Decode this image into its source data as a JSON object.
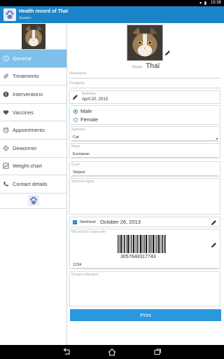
{
  "status_bar": {
    "time": "15:36"
  },
  "action_bar": {
    "title": "Health record of Thaï",
    "subtitle": "Ajouter"
  },
  "sidebar": {
    "items": [
      {
        "label": "General",
        "icon": "info-icon",
        "active": true
      },
      {
        "label": "Treatments",
        "icon": "pill-icon"
      },
      {
        "label": "Interventions",
        "icon": "alert-icon"
      },
      {
        "label": "Vaccines",
        "icon": "heart-icon"
      },
      {
        "label": "Appointments",
        "icon": "alarm-icon"
      },
      {
        "label": "Dewormer",
        "icon": "diamond-icon"
      },
      {
        "label": "Weight chart",
        "icon": "chart-icon"
      },
      {
        "label": "Contact details",
        "icon": "phone-icon"
      }
    ]
  },
  "profile": {
    "name_label": "Name",
    "name_value": "Thaï"
  },
  "fields": {
    "nickname_label": "Nickname",
    "pedigree_label": "Pedigree",
    "birthday_label": "Birthday",
    "birthday_value": "April 20, 2013",
    "gender_options": [
      "Male",
      "Female"
    ],
    "gender_selected": "Male",
    "species_label": "Species",
    "species_value": "Cat",
    "race_label": "Race",
    "race_value": "European",
    "coat_label": "Coat",
    "coat_value": "Striped",
    "special_signs_label": "Special signs",
    "sterilized_label": "Sterilized",
    "sterilized_date": "October 26, 2013",
    "microchip_label": "Microchip's barcode",
    "barcode_number": "3057640317743",
    "microchip_value": "1234",
    "allergies_label": "Known allergies"
  },
  "print_label": "Print",
  "colors": {
    "accent": "#1b84c9",
    "menu_active": "#7fbfe9",
    "button": "#2a97df"
  }
}
